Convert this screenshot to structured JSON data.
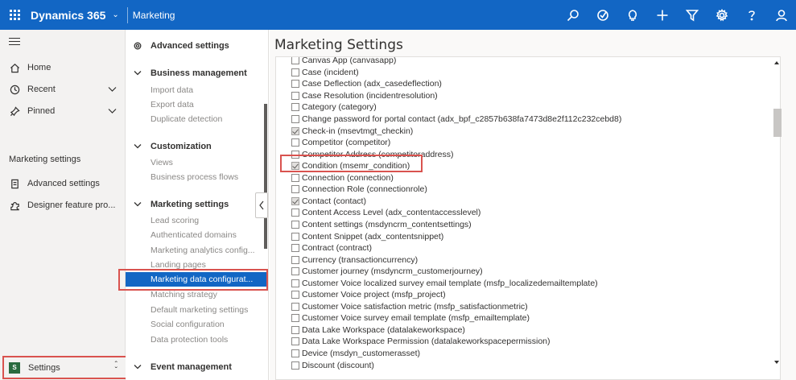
{
  "topbar": {
    "app_title": "Dynamics 365",
    "area_name": "Marketing",
    "icons": [
      "search-icon",
      "target-icon",
      "lightbulb-icon",
      "plus-icon",
      "filter-icon",
      "gear-icon",
      "help-icon",
      "user-icon"
    ]
  },
  "leftnav": {
    "items": [
      {
        "label": "Home",
        "icon": "home-icon"
      },
      {
        "label": "Recent",
        "icon": "clock-icon"
      },
      {
        "label": "Pinned",
        "icon": "pin-icon"
      }
    ],
    "section_title": "Marketing settings",
    "section_items": [
      {
        "label": "Advanced settings",
        "icon": "settings-doc-icon"
      },
      {
        "label": "Designer feature pro...",
        "icon": "puzzle-icon"
      }
    ],
    "area_switcher": {
      "avatar": "S",
      "label": "Settings"
    }
  },
  "subnav": {
    "top_item": "Advanced settings",
    "groups": [
      {
        "title": "Business management",
        "items": [
          "Import data",
          "Export data",
          "Duplicate detection"
        ]
      },
      {
        "title": "Customization",
        "items": [
          "Views",
          "Business process flows"
        ]
      },
      {
        "title": "Marketing settings",
        "items": [
          "Lead scoring",
          "Authenticated domains",
          "Marketing analytics config...",
          "Landing pages",
          "Marketing data configurat...",
          "Matching strategy",
          "Default marketing settings",
          "Social configuration",
          "Data protection tools"
        ]
      },
      {
        "title": "Event management",
        "items": []
      }
    ],
    "selected": "Marketing data configurat..."
  },
  "main": {
    "title": "Marketing Settings",
    "entities": [
      {
        "label": "Canvas App (canvasapp)",
        "checked": false
      },
      {
        "label": "Case (incident)",
        "checked": false
      },
      {
        "label": "Case Deflection (adx_casedeflection)",
        "checked": false
      },
      {
        "label": "Case Resolution (incidentresolution)",
        "checked": false
      },
      {
        "label": "Category (category)",
        "checked": false
      },
      {
        "label": "Change password for portal contact (adx_bpf_c2857b638fa7473d8e2f112c232cebd8)",
        "checked": false
      },
      {
        "label": "Check-in (msevtmgt_checkin)",
        "checked": true
      },
      {
        "label": "Competitor (competitor)",
        "checked": false
      },
      {
        "label": "Competitor Address (competitoraddress)",
        "checked": false
      },
      {
        "label": "Condition (msemr_condition)",
        "checked": true
      },
      {
        "label": "Connection (connection)",
        "checked": false
      },
      {
        "label": "Connection Role (connectionrole)",
        "checked": false
      },
      {
        "label": "Contact (contact)",
        "checked": true
      },
      {
        "label": "Content Access Level (adx_contentaccesslevel)",
        "checked": false
      },
      {
        "label": "Content settings (msdyncrm_contentsettings)",
        "checked": false
      },
      {
        "label": "Content Snippet (adx_contentsnippet)",
        "checked": false
      },
      {
        "label": "Contract (contract)",
        "checked": false
      },
      {
        "label": "Currency (transactioncurrency)",
        "checked": false
      },
      {
        "label": "Customer journey (msdyncrm_customerjourney)",
        "checked": false
      },
      {
        "label": "Customer Voice localized survey email template (msfp_localizedemailtemplate)",
        "checked": false
      },
      {
        "label": "Customer Voice project (msfp_project)",
        "checked": false
      },
      {
        "label": "Customer Voice satisfaction metric (msfp_satisfactionmetric)",
        "checked": false
      },
      {
        "label": "Customer Voice survey email template (msfp_emailtemplate)",
        "checked": false
      },
      {
        "label": "Data Lake Workspace (datalakeworkspace)",
        "checked": false
      },
      {
        "label": "Data Lake Workspace Permission (datalakeworkspacepermission)",
        "checked": false
      },
      {
        "label": "Device (msdyn_customerasset)",
        "checked": false
      },
      {
        "label": "Discount (discount)",
        "checked": false
      }
    ]
  }
}
